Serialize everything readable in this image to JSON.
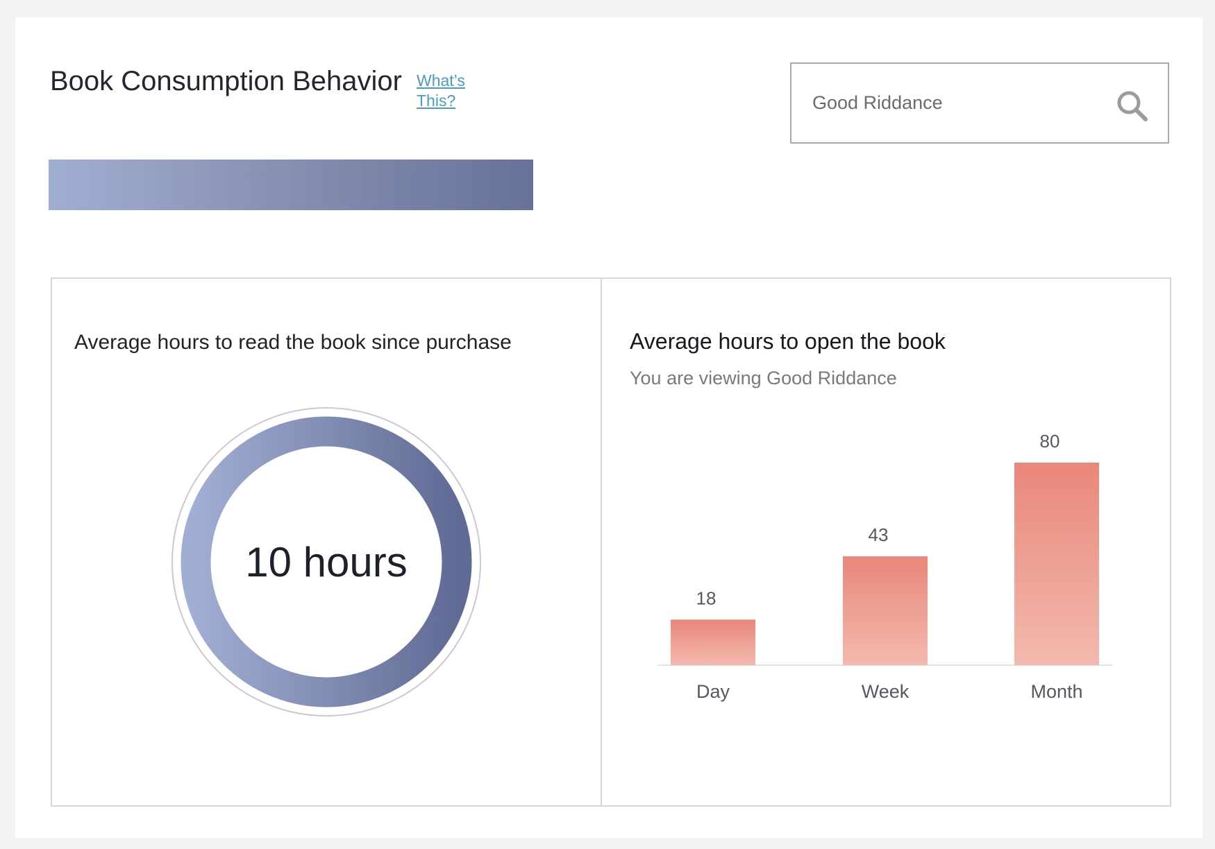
{
  "header": {
    "title": "Book Consumption Behavior",
    "help_link": "What’s This?"
  },
  "search": {
    "value": "Good Riddance",
    "placeholder": ""
  },
  "accent_gradient": [
    "#a1aed3",
    "#67729a"
  ],
  "left_panel": {
    "title": "Average hours to read the book since purchase",
    "metric_label": "10 hours",
    "metric_value": 10,
    "metric_unit": "hours"
  },
  "right_panel": {
    "title": "Average hours to open the book",
    "subtitle": "You are viewing Good Riddance"
  },
  "chart_data": {
    "type": "bar",
    "categories": [
      "Day",
      "Week",
      "Month"
    ],
    "values": [
      18,
      43,
      80
    ],
    "title": "Average hours to open the book",
    "xlabel": "",
    "ylabel": "",
    "ylim": [
      0,
      80
    ],
    "data_labels": true,
    "grid": false,
    "bar_color_top": "#e9877a",
    "bar_color_bottom": "#f3b9ae"
  }
}
